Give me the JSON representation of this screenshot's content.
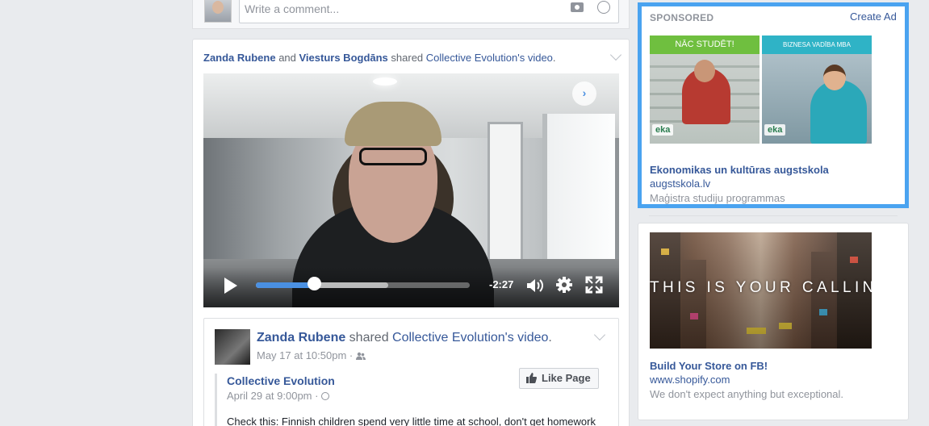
{
  "comment_box": {
    "placeholder": "Write a comment..."
  },
  "post": {
    "actor1": "Zanda Rubene",
    "conj": " and ",
    "actor2": "Viesturs Bogdāns",
    "verb": " shared ",
    "page": "Collective Evolution",
    "possessive": "'s ",
    "object": "video",
    "period": "."
  },
  "video": {
    "time_remaining": "-2:27",
    "progress": 0.27,
    "buffered": 0.62,
    "next_label": "›"
  },
  "shared_post": {
    "author": "Zanda Rubene",
    "verb": " shared ",
    "page": "Collective Evolution",
    "possessive": "'s ",
    "object": "video",
    "period": ".",
    "timestamp": "May 17 at 10:50pm · ",
    "inner": {
      "page_name": "Collective Evolution",
      "timestamp": "April 29 at 9:00pm · ",
      "like_button": "Like Page",
      "text": "Check this: Finnish children spend very little time at school, don't get homework"
    }
  },
  "sponsored_ad": {
    "header": "SPONSORED",
    "create_ad": "Create Ad",
    "image1_banner": "NĀC STUDĒT!",
    "image2_banner": "BIZNESA VADĪBA MBA",
    "logo_text": "eka",
    "title": "Ekonomikas un kultūras augstskola",
    "url": "augstskola.lv",
    "description": "Maģistra studiju programmas"
  },
  "shopify_ad": {
    "image_text": "THIS IS YOUR CALLING",
    "title": "Build Your Store on FB!",
    "url": "www.shopify.com",
    "description": "We don't expect anything but exceptional."
  },
  "colors": {
    "link": "#365899",
    "highlight_border": "#4aa3f0",
    "progress": "#4a90e2",
    "background": "#e9ebee"
  }
}
